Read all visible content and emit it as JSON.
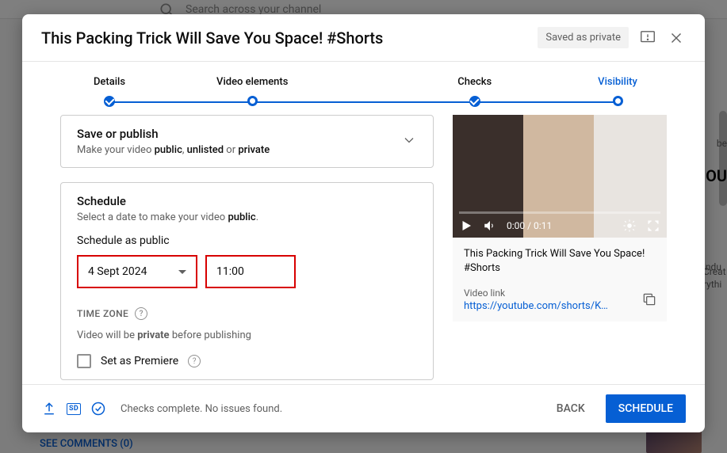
{
  "background": {
    "search_placeholder": "Search across your channel",
    "comments": "SEE COMMENTS (0)",
    "side_t1": "indu",
    "side_t2": "Creat",
    "side_t3": "rythi",
    "side_big": "OU",
    "side_be": "be"
  },
  "modal": {
    "title": "This Packing Trick Will Save You Space! #Shorts",
    "saved": "Saved as private"
  },
  "steps": {
    "s1": "Details",
    "s2": "Video elements",
    "s3": "Checks",
    "s4": "Visibility"
  },
  "save_publish": {
    "title": "Save or publish",
    "sub_pre": "Make your video ",
    "sub_b1": "public",
    "sub_sep1": ", ",
    "sub_b2": "unlisted",
    "sub_sep2": " or ",
    "sub_b3": "private"
  },
  "schedule": {
    "title": "Schedule",
    "sub_pre": "Select a date to make your video ",
    "sub_b": "public",
    "as_label": "Schedule as public",
    "date": "4 Sept 2024",
    "time": "11:00",
    "timezone": "TIME ZONE",
    "note_pre": "Video will be ",
    "note_b": "private",
    "note_post": " before publishing",
    "premiere": "Set as Premiere"
  },
  "player": {
    "time": "0:00 / 0:11",
    "title": "This Packing Trick Will Save You Space! #Shorts",
    "link_label": "Video link",
    "link": "https://youtube.com/shorts/KO..."
  },
  "footer": {
    "sd": "SD",
    "msg": "Checks complete. No issues found.",
    "back": "BACK",
    "schedule": "SCHEDULE"
  }
}
